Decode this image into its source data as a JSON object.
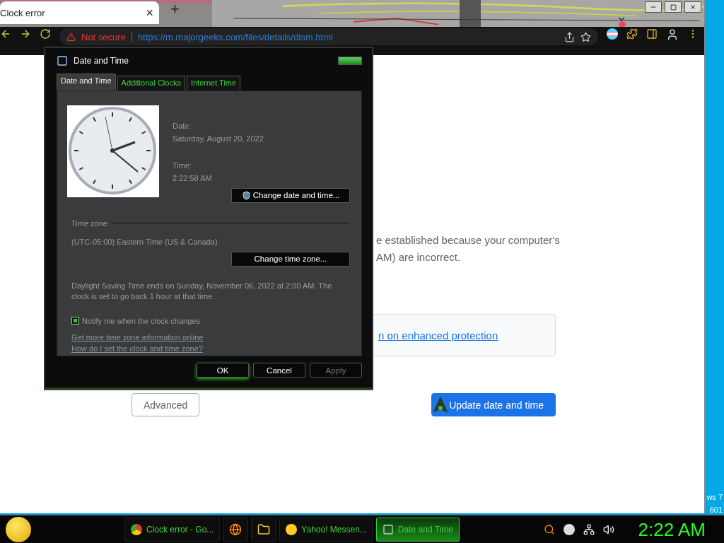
{
  "browser": {
    "tab": {
      "title": "Clock error",
      "close": "×"
    },
    "new_tab": "+",
    "address_bar": {
      "security": "Not secure",
      "url": "https://m.majorgeeks.com/files/details/dism.html"
    }
  },
  "page": {
    "message_lines": [
      "e established because your computer's",
      "AM) are incorrect."
    ],
    "protection_link": "n on enhanced protection",
    "buttons": [
      {
        "label": "Advanced",
        "kind": "secondary"
      },
      {
        "label": "Update date and time",
        "kind": "primary"
      }
    ]
  },
  "desktop_text": [
    "ws 7",
    "601"
  ],
  "dialog": {
    "title": "Date and Time",
    "tabs": [
      {
        "label": "Date and Time",
        "selected": true
      },
      {
        "label": "Additional Clocks",
        "selected": false
      },
      {
        "label": "Internet Time",
        "selected": false
      }
    ],
    "date_label": "Date:",
    "date": "Saturday, August 20, 2022",
    "time_label": "Time:",
    "time": "2:22:58 AM",
    "change_datetime_button": "Change date and time...",
    "time_zone_heading": "Time zone",
    "time_zone": "(UTC-05:00) Eastern Time (US & Canada)",
    "change_zone_button": "Change time zone...",
    "dst_note": "Daylight Saving Time ends on Sunday, November 06, 2022 at 2:00 AM. The clock is set to go back 1 hour at that time.",
    "notify": {
      "label": "Notify me when the clock changes",
      "checked": true
    },
    "links": [
      "Get more time zone information online",
      "How do I set the clock and time zone?"
    ],
    "buttons": [
      {
        "label": "OK",
        "disabled": false
      },
      {
        "label": "Cancel",
        "disabled": false
      },
      {
        "label": "Apply",
        "disabled": true
      }
    ]
  },
  "taskbar": {
    "items": [
      {
        "kind": "window",
        "label": "Clock error - Go...",
        "selected": false
      },
      {
        "kind": "pinned",
        "selected": false
      },
      {
        "kind": "pinned",
        "selected": false
      },
      {
        "kind": "window",
        "label": "Yahoo! Messen...",
        "selected": false
      },
      {
        "kind": "window",
        "label": "Date and Time",
        "selected": true
      }
    ],
    "clock": "2:22 AM"
  }
}
